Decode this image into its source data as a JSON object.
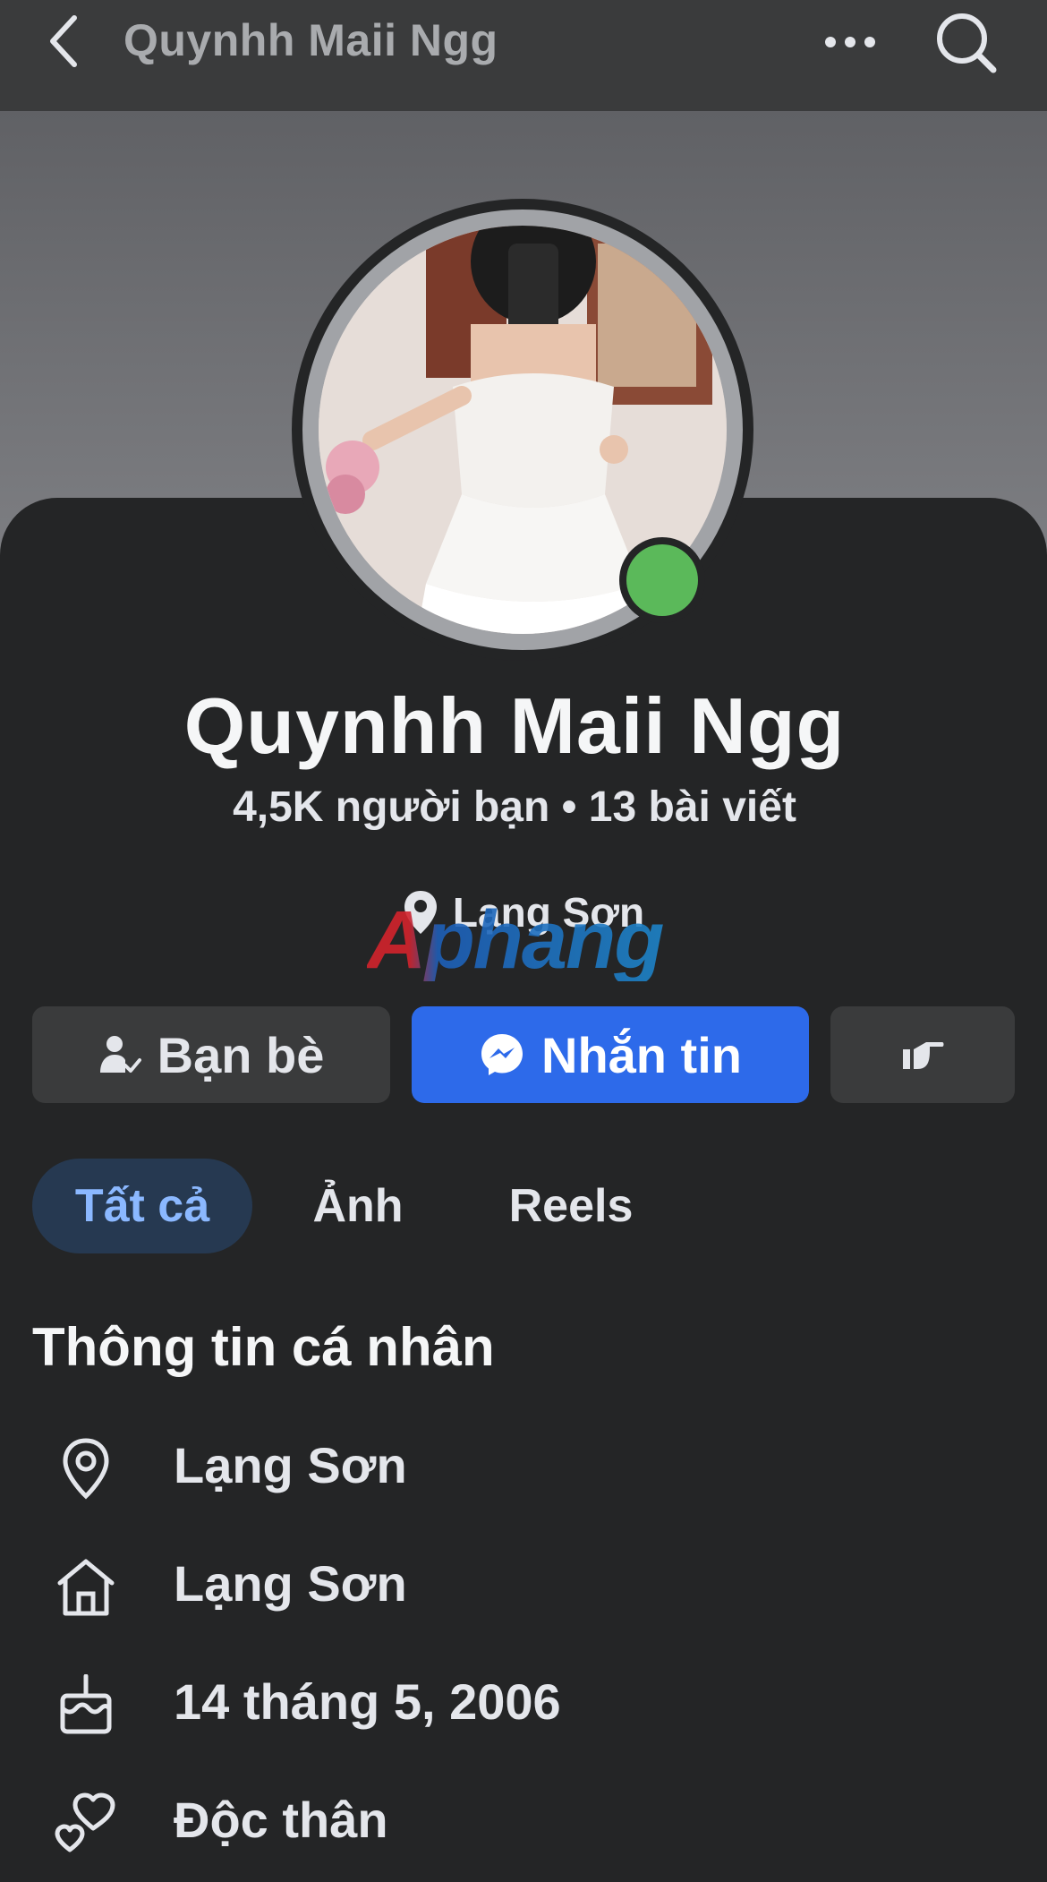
{
  "header": {
    "title": "Quynhh Maii Ngg",
    "back_icon": "chevron-left-icon",
    "more_icon": "more-horizontal-icon",
    "search_icon": "search-icon"
  },
  "profile": {
    "name": "Quynhh Maii Ngg",
    "stats": "4,5K người bạn • 13 bài viết",
    "location": "Lạng Sơn",
    "online": true,
    "online_color": "#5bb95a"
  },
  "watermark": "Aphang",
  "actions": {
    "friends_label": "Bạn bè",
    "message_label": "Nhắn tin",
    "message_color": "#2d6aea"
  },
  "tabs": [
    {
      "label": "Tất cả",
      "active": true
    },
    {
      "label": "Ảnh",
      "active": false
    },
    {
      "label": "Reels",
      "active": false
    }
  ],
  "info": {
    "title": "Thông tin cá nhân",
    "items": [
      {
        "icon": "map-pin-icon",
        "text": "Lạng Sơn"
      },
      {
        "icon": "home-icon",
        "text": "Lạng Sơn"
      },
      {
        "icon": "birthday-cake-icon",
        "text": "14 tháng 5, 2006"
      },
      {
        "icon": "hearts-icon",
        "text": "Độc thân"
      }
    ]
  }
}
